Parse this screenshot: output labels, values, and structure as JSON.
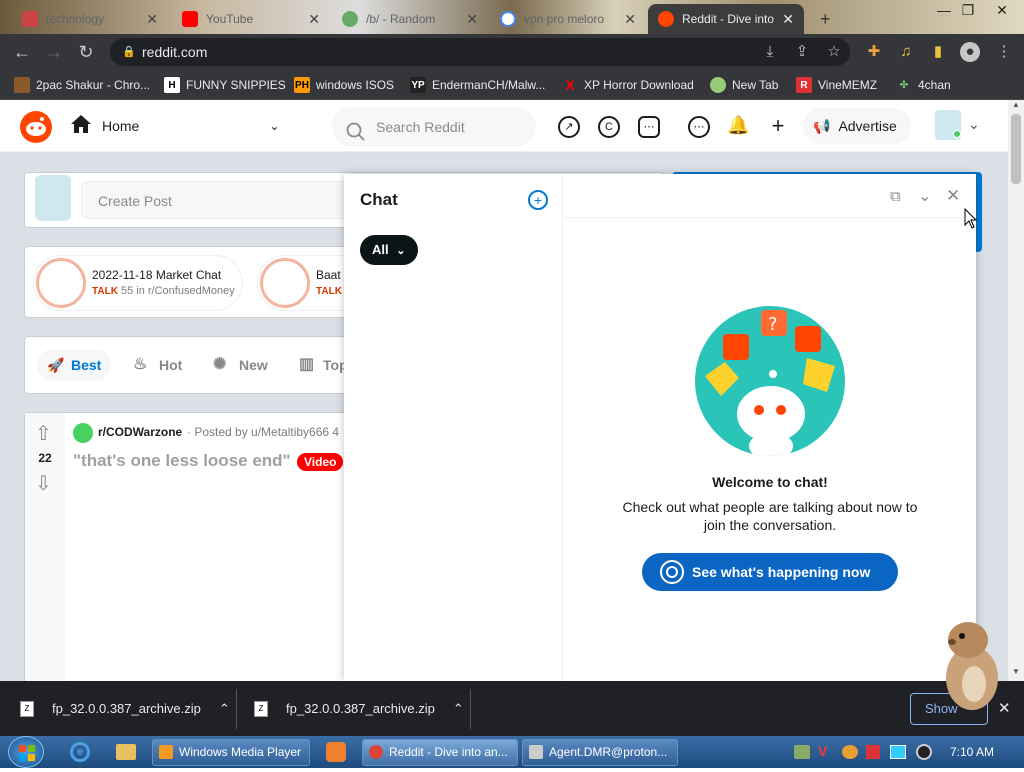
{
  "browser": {
    "tabs": [
      {
        "title": "technology",
        "active": false
      },
      {
        "title": "YouTube",
        "active": false
      },
      {
        "title": "/b/ - Random",
        "active": false
      },
      {
        "title": "vpn pro meloro",
        "active": false
      },
      {
        "title": "Reddit - Dive into",
        "active": true
      }
    ],
    "new_tab": "+",
    "url": "reddit.com",
    "bookmarks": [
      {
        "label": "2pac Shakur - Chro...",
        "icon": "tupac-icon"
      },
      {
        "label": "FUNNY SNIPPIES",
        "icon": "h-icon"
      },
      {
        "label": "windows ISOS",
        "icon": "ph-icon"
      },
      {
        "label": "EndermanCH/Malw...",
        "icon": "yp-icon"
      },
      {
        "label": "XP Horror Download",
        "icon": "x-icon"
      },
      {
        "label": "New Tab",
        "icon": "globe-icon"
      },
      {
        "label": "VineMEMZ",
        "icon": "r-icon"
      },
      {
        "label": "4chan",
        "icon": "clover-icon"
      }
    ]
  },
  "reddit": {
    "home_label": "Home",
    "search_placeholder": "Search Reddit",
    "advertise_label": "Advertise",
    "create_post_placeholder": "Create Post",
    "talks": [
      {
        "title": "2022-11-18 Market Chat",
        "badge": "TALK",
        "meta": "55 in r/ConfusedMoney"
      },
      {
        "title": "Baat",
        "badge": "TALK",
        "meta": ""
      }
    ],
    "sort_tabs": [
      "Best",
      "Hot",
      "New",
      "Top"
    ],
    "post": {
      "votes": "22",
      "subreddit": "r/CODWarzone",
      "posted_by": "· Posted by u/Metaltiby666 4",
      "title": "\"that's one less loose end\"",
      "flair": "Video"
    }
  },
  "chat": {
    "title": "Chat",
    "filter": "All",
    "welcome_title": "Welcome to chat!",
    "welcome_text": "Check out what people are talking about now to join the conversation.",
    "cta_label": "See what's happening now"
  },
  "downloads": [
    {
      "name": "fp_32.0.0.387_archive.zip"
    },
    {
      "name": "fp_32.0.0.387_archive.zip"
    }
  ],
  "downloads_show_all": "Show",
  "taskbar": {
    "tasks": [
      {
        "label": "Windows Media Player"
      },
      {
        "label": "Reddit - Dive into an..."
      },
      {
        "label": "Agent.DMR@proton..."
      }
    ],
    "clock": "7:10 AM"
  },
  "colors": {
    "reddit_orange": "#ff4500",
    "chat_cta": "#0a66c2",
    "talk_orange": "#d93a00",
    "video_flair": "#ff0000"
  }
}
